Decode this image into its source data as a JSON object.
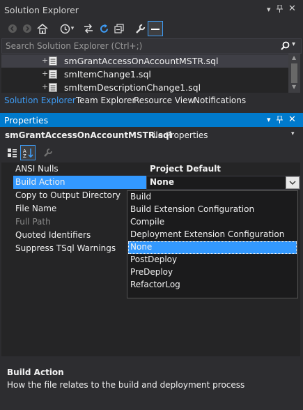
{
  "solution_explorer": {
    "title": "Solution Explorer",
    "pin_glyph": "▾",
    "search_placeholder": "Search Solution Explorer (Ctrl+;)",
    "files": [
      {
        "name": "smGrantAccessOnAccountMSTR.sql",
        "selected": true
      },
      {
        "name": "smItemChange1.sql",
        "selected": false
      },
      {
        "name": "smItemDescriptionChange1.sql",
        "selected": false
      }
    ],
    "tabs": [
      {
        "label": "Solution Explorer",
        "active": true
      },
      {
        "label": "Team Explorer",
        "active": false
      },
      {
        "label": "Resource View",
        "active": false
      },
      {
        "label": "Notifications",
        "active": false
      }
    ]
  },
  "properties": {
    "title": "Properties",
    "object_name": "smGrantAccessOnAccountMSTR.sql",
    "object_type": "File Properties",
    "rows": [
      {
        "name": "ANSI Nulls",
        "value": "Project Default",
        "bold": true,
        "dim": false
      },
      {
        "name": "Build Action",
        "value": "None",
        "bold": true,
        "dim": false,
        "selected": true
      },
      {
        "name": "Copy to Output Directory",
        "value": "",
        "dim": false
      },
      {
        "name": "File Name",
        "value": "",
        "dim": false
      },
      {
        "name": "Full Path",
        "value": "",
        "dim": true
      },
      {
        "name": "Quoted Identifiers",
        "value": "",
        "dim": false
      },
      {
        "name": "Suppress TSql Warnings",
        "value": "",
        "dim": false
      }
    ],
    "dropdown_options": [
      "Build",
      "Build Extension Configuration",
      "Compile",
      "Deployment Extension Configuration",
      "None",
      "PostDeploy",
      "PreDeploy",
      "RefactorLog"
    ],
    "dropdown_selected": "None",
    "description": {
      "heading": "Build Action",
      "body": "How the file relates to the build and deployment process"
    }
  },
  "colors": {
    "accent": "#007acc",
    "selection": "#3399ff",
    "background": "#2d2d30",
    "panel": "#252526"
  }
}
